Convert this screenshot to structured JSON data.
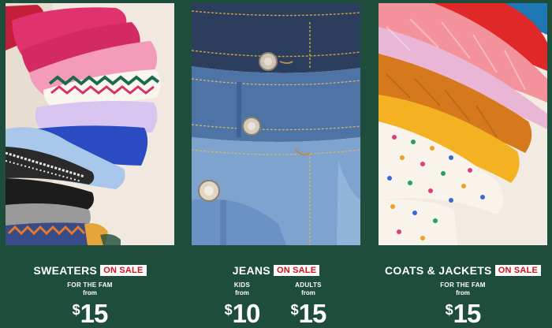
{
  "categories": [
    {
      "name": "SWEATERS",
      "badge": "ON SALE",
      "prices": [
        {
          "label": "FOR THE FAM",
          "from": "from",
          "currency": "$",
          "amount": "15"
        }
      ],
      "image": {
        "icon": "stacked-sweaters-image"
      }
    },
    {
      "name": "JEANS",
      "badge": "ON SALE",
      "prices": [
        {
          "label": "KIDS",
          "from": "from",
          "currency": "$",
          "amount": "10"
        },
        {
          "label": "ADULTS",
          "from": "from",
          "currency": "$",
          "amount": "15"
        }
      ],
      "image": {
        "icon": "stacked-jeans-image"
      }
    },
    {
      "name": "COATS & JACKETS",
      "badge": "ON SALE",
      "prices": [
        {
          "label": "FOR THE FAM",
          "from": "from",
          "currency": "$",
          "amount": "15"
        }
      ],
      "image": {
        "icon": "stacked-puffer-jackets-image"
      }
    }
  ],
  "colors": {
    "background": "#1f4d3c",
    "badge_text": "#d2111b",
    "text": "#ffffff"
  }
}
